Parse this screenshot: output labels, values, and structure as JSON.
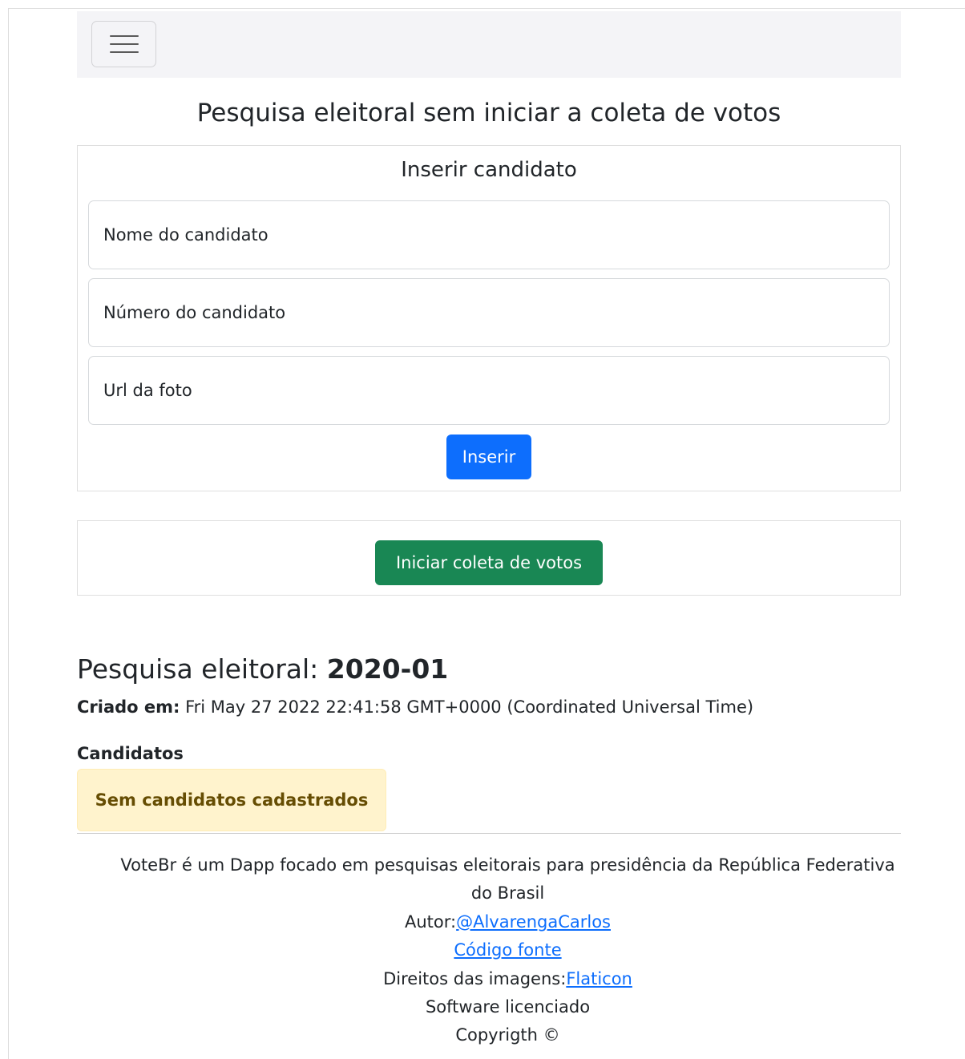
{
  "navbar": {
    "menu_icon": "hamburger-menu-icon"
  },
  "page_title": "Pesquisa eleitoral sem iniciar a coleta de votos",
  "insert_card": {
    "heading": "Inserir candidato",
    "fields": {
      "name_placeholder": "Nome do candidato",
      "number_placeholder": "Número do candidato",
      "photo_placeholder": "Url da foto"
    },
    "insert_button": "Inserir"
  },
  "start_card": {
    "start_button": "Iniciar coleta de votos"
  },
  "survey": {
    "title_prefix": "Pesquisa eleitoral: ",
    "title_id": "2020-01",
    "created_label": "Criado em:",
    "created_value": " Fri May 27 2022 22:41:58 GMT+0000 (Coordinated Universal Time)",
    "candidates_heading": "Candidatos",
    "empty_alert": "Sem candidatos cadastrados"
  },
  "footer": {
    "description": "VoteBr é um Dapp focado em pesquisas eleitorais para presidência da República Federativa do Brasil",
    "author_label": "Autor:",
    "author_link": "@AlvarengaCarlos",
    "source_link": "Código fonte",
    "images_label": "Direitos das imagens:",
    "images_link": "Flaticon",
    "license": "Software licenciado",
    "copyright": "Copyrigth ©"
  },
  "colors": {
    "primary": "#0d6efd",
    "success": "#198754",
    "alert_bg": "#fff3cd",
    "alert_text": "#664d03",
    "navbar_bg": "#f4f4f7"
  }
}
